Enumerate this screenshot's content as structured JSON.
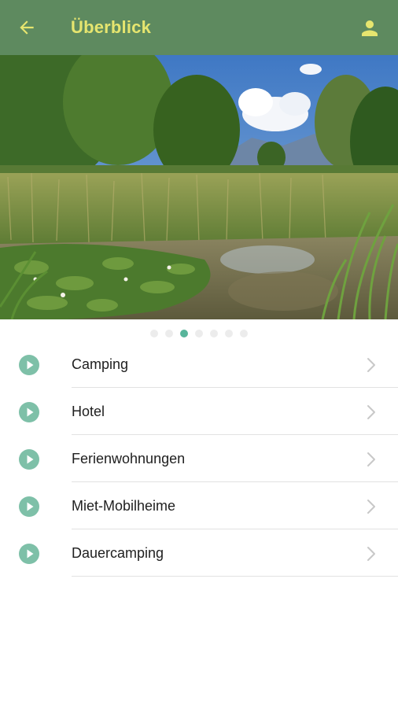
{
  "appbar": {
    "title": "Überblick",
    "back_icon": "arrow-left-icon",
    "profile_icon": "person-icon",
    "background": "#5e8a5f",
    "accent": "#e6e56f"
  },
  "hero": {
    "image": "pond-landscape"
  },
  "carousel": {
    "total": 7,
    "active_index": 2,
    "active_color": "#58b59b"
  },
  "menu": {
    "items": [
      {
        "label": "Camping"
      },
      {
        "label": "Hotel"
      },
      {
        "label": "Ferienwohnungen"
      },
      {
        "label": "Miet-Mobilheime"
      },
      {
        "label": "Dauercamping"
      }
    ],
    "icon": "play-circle-icon",
    "trailing_icon": "chevron-right-icon",
    "icon_color": "#7ec0a8"
  }
}
